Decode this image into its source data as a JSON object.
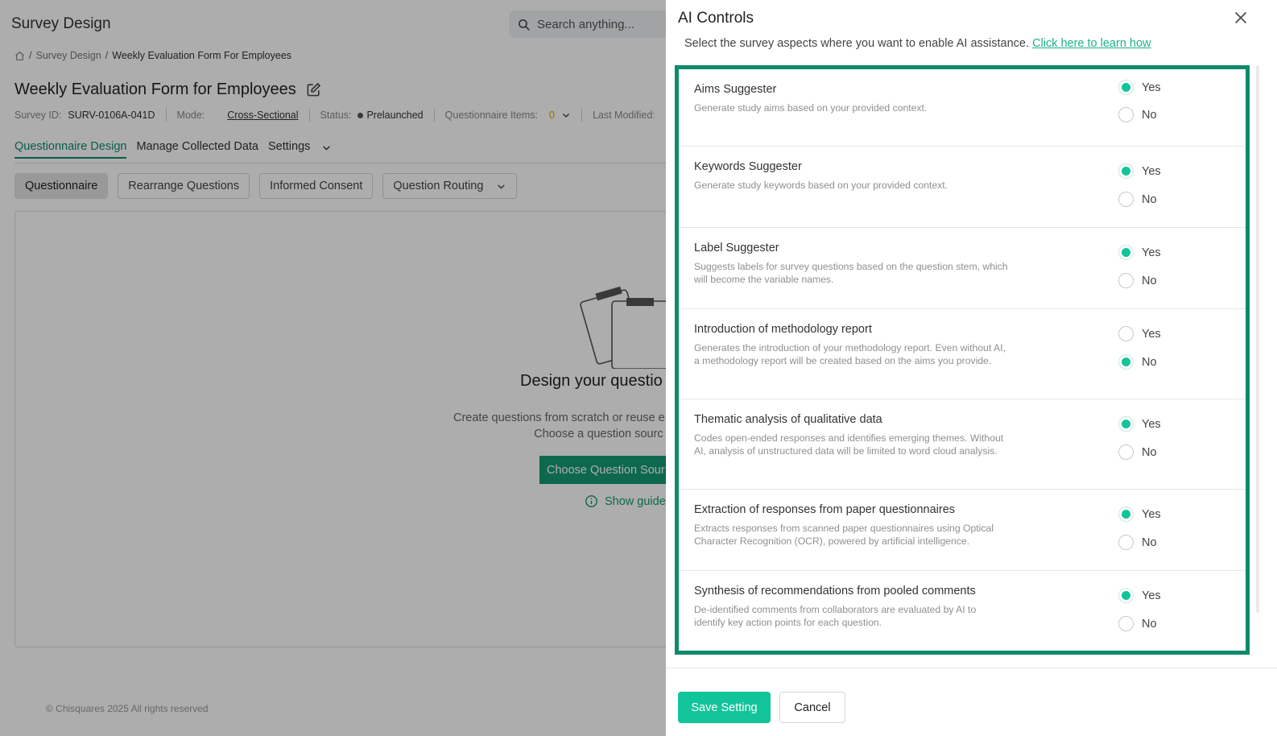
{
  "app": {
    "title": "Survey Design"
  },
  "search": {
    "placeholder": "Search anything..."
  },
  "breadcrumb": {
    "items": [
      "Survey Design",
      "Weekly Evaluation Form For Employees"
    ]
  },
  "survey": {
    "title": "Weekly Evaluation Form for Employees",
    "meta": {
      "id_label": "Survey ID:",
      "id_value": "SURV-0106A-041D",
      "mode_label": "Mode:",
      "mode_value": "Cross-Sectional",
      "status_label": "Status:",
      "status_value": "Prelaunched",
      "items_label": "Questionnaire Items:",
      "items_value": "0",
      "modified_label": "Last Modified:"
    }
  },
  "tabs": [
    "Questionnaire Design",
    "Manage Collected Data",
    "Settings"
  ],
  "subtabs": [
    "Questionnaire",
    "Rearrange Questions",
    "Informed Consent",
    "Question Routing"
  ],
  "empty_state": {
    "title": "Design your questio",
    "desc_line1": "Create questions from scratch or reuse e",
    "desc_line2": "Choose a question sourc",
    "button": "Choose Question Sour",
    "guide": "Show guide"
  },
  "footer": {
    "copyright": "© Chisquares 2025 All rights reserved"
  },
  "drawer": {
    "title": "AI Controls",
    "subtitle": "Select the survey aspects where you want to enable AI assistance. ",
    "learn_link": "Click here to learn how",
    "yes_label": "Yes",
    "no_label": "No",
    "settings": [
      {
        "title": "Aims Suggester",
        "desc": "Generate study aims based on your provided context.",
        "value": "Yes"
      },
      {
        "title": "Keywords Suggester",
        "desc": "Generate study keywords based on your provided context.",
        "value": "Yes"
      },
      {
        "title": "Label Suggester",
        "desc": "Suggests labels for survey questions based on the question stem, which will become the variable names.",
        "value": "Yes"
      },
      {
        "title": "Introduction of methodology report",
        "desc": "Generates the introduction of your methodology report. Even without AI, a methodology report will be created based on the aims you provide.",
        "value": "No"
      },
      {
        "title": "Thematic analysis of qualitative data",
        "desc": "Codes open-ended responses and identifies emerging themes. Without AI, analysis of unstructured data will be limited to word cloud analysis.",
        "value": "Yes"
      },
      {
        "title": "Extraction of responses from paper questionnaires",
        "desc": "Extracts responses from scanned paper questionnaires using Optical Character Recognition (OCR), powered by artificial intelligence.",
        "value": "Yes"
      },
      {
        "title": "Synthesis of recommendations from pooled comments",
        "desc": "De-identified comments from collaborators are evaluated by AI to identify key action points for each question.",
        "value": "Yes"
      }
    ],
    "save_label": "Save Setting",
    "cancel_label": "Cancel"
  }
}
